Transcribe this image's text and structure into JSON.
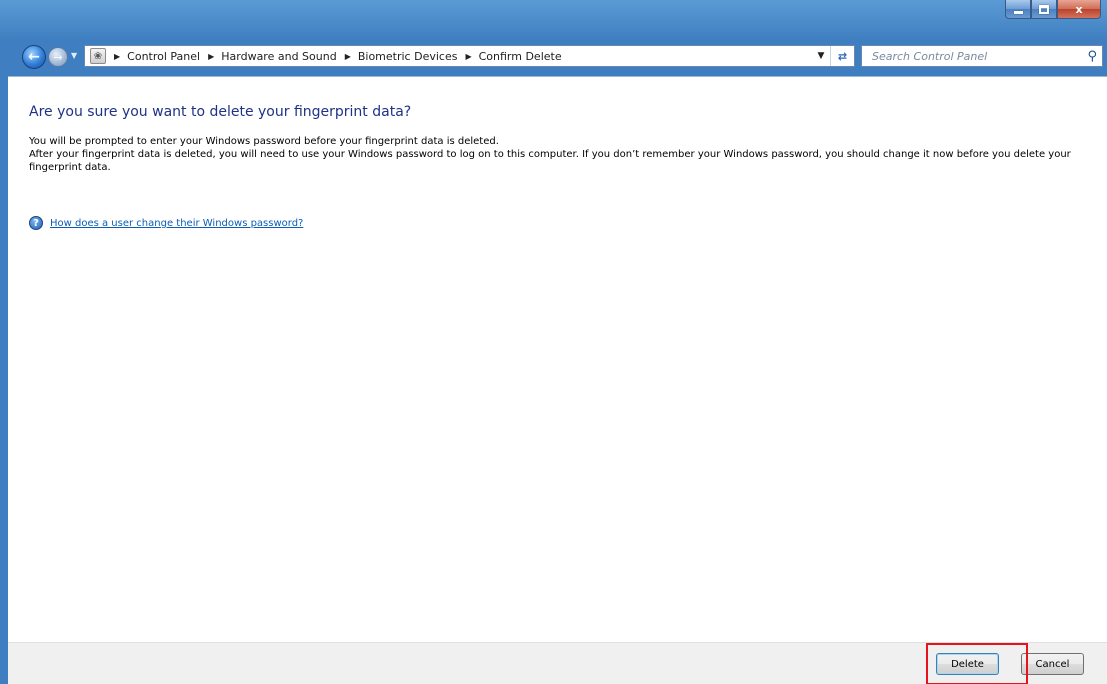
{
  "window": {
    "caption_buttons": {
      "minimize": "minimize",
      "maximize": "maximize",
      "close": "x"
    }
  },
  "navigation": {
    "back_icon": "back-arrow-icon",
    "forward_icon": "forward-arrow-icon",
    "breadcrumbs": [
      "Control Panel",
      "Hardware and Sound",
      "Biometric Devices",
      "Confirm Delete"
    ],
    "search": {
      "placeholder": "Search Control Panel"
    }
  },
  "main": {
    "heading": "Are you sure you want to delete your fingerprint data?",
    "paragraph1": "You will be prompted to enter your Windows password before your fingerprint data is deleted.",
    "paragraph2": "After your fingerprint data is deleted, you will need to use your Windows password to log on to this computer.  If you don’t remember your Windows password, you should change it now before you delete your fingerprint data.",
    "help_link": "How does a user change their Windows password?"
  },
  "footer": {
    "delete_label": "Delete",
    "cancel_label": "Cancel"
  },
  "colors": {
    "heading": "#1e3287",
    "link": "#0b5db8",
    "highlight": "#e8121e"
  }
}
